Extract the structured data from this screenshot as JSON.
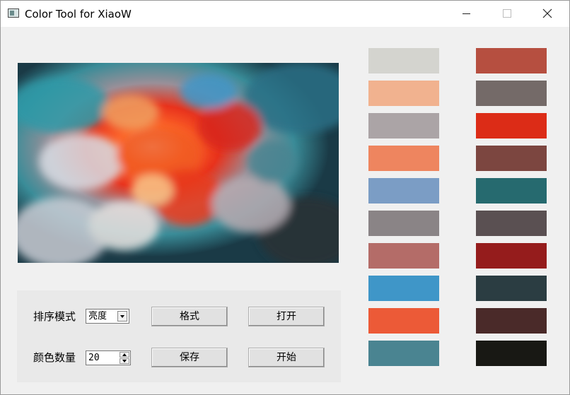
{
  "window": {
    "title": "Color Tool for XiaoW"
  },
  "image": {
    "description_icon": "abstract-color-explosion-image"
  },
  "controls": {
    "sort_label": "排序模式",
    "sort_value": "亮度",
    "count_label": "颜色数量",
    "count_value": "20",
    "format_button": "格式",
    "open_button": "打开",
    "save_button": "保存",
    "start_button": "开始"
  },
  "palette": {
    "left": [
      "#d4d4cf",
      "#f1b28f",
      "#aba4a6",
      "#ee855f",
      "#7b9dc5",
      "#8a8486",
      "#b46c68",
      "#3f96c8",
      "#ec5a37",
      "#4a8491"
    ],
    "right": [
      "#b64f40",
      "#746a68",
      "#dc2c17",
      "#7c4640",
      "#266a6f",
      "#5a5052",
      "#951c1c",
      "#2b3d42",
      "#4a2a29",
      "#181814"
    ]
  }
}
